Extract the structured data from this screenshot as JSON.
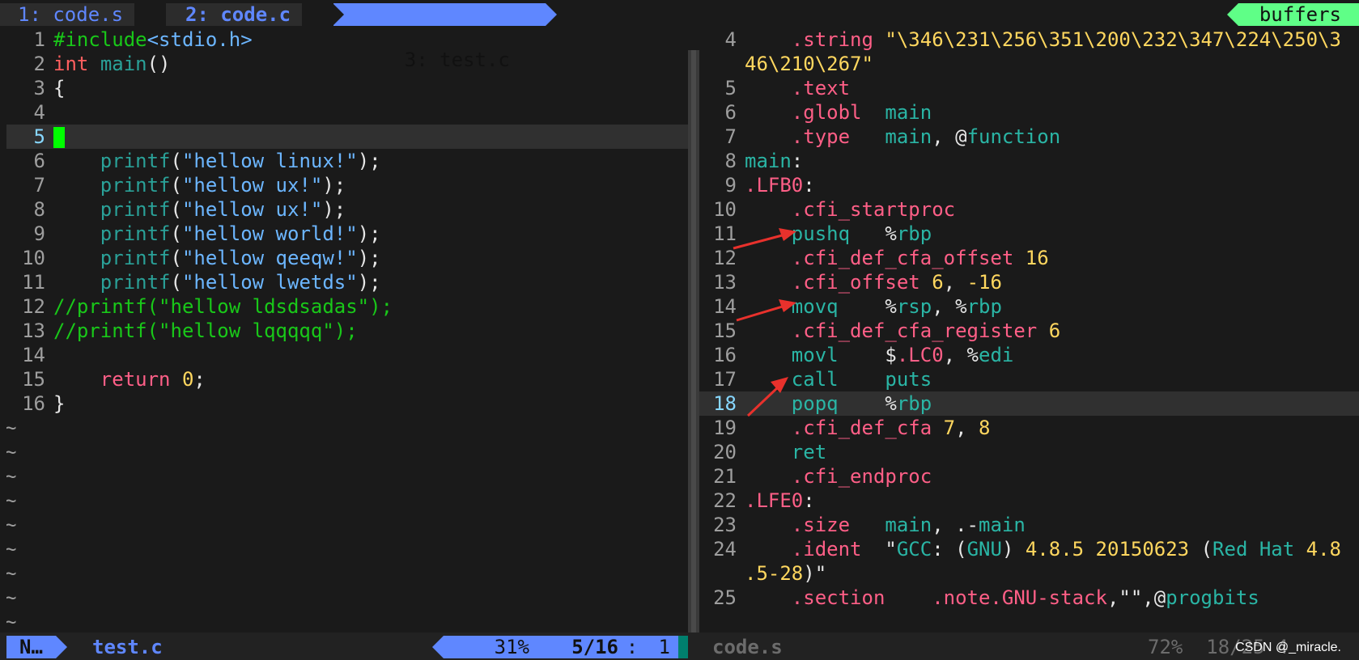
{
  "tabs": [
    {
      "label": "1: code.s"
    },
    {
      "label": "2: code.c"
    },
    {
      "label": "3: test.c"
    }
  ],
  "buffers_label": "buffers",
  "left_pane": {
    "lines": [
      {
        "n": "1",
        "parts": [
          [
            "cmt-green-inc",
            "#include"
          ],
          [
            "str-blue",
            "<stdio.h>"
          ]
        ]
      },
      {
        "n": "2",
        "parts": [
          [
            "kw-red",
            "int"
          ],
          [
            "white",
            " "
          ],
          [
            "fn-teal",
            "main"
          ],
          [
            "white",
            "()"
          ]
        ]
      },
      {
        "n": "3",
        "parts": [
          [
            "white",
            "{"
          ]
        ]
      },
      {
        "n": "4",
        "parts": []
      },
      {
        "n": "5",
        "parts": [],
        "current": true,
        "cursor": true
      },
      {
        "n": "6",
        "parts": [
          [
            "white",
            "    "
          ],
          [
            "fn-teal",
            "printf"
          ],
          [
            "white",
            "("
          ],
          [
            "str-blue",
            "\"hellow linux!\""
          ],
          [
            "white",
            ");"
          ]
        ]
      },
      {
        "n": "7",
        "parts": [
          [
            "white",
            "    "
          ],
          [
            "fn-teal",
            "printf"
          ],
          [
            "white",
            "("
          ],
          [
            "str-blue",
            "\"hellow ux!\""
          ],
          [
            "white",
            ");"
          ]
        ]
      },
      {
        "n": "8",
        "parts": [
          [
            "white",
            "    "
          ],
          [
            "fn-teal",
            "printf"
          ],
          [
            "white",
            "("
          ],
          [
            "str-blue",
            "\"hellow ux!\""
          ],
          [
            "white",
            ");"
          ]
        ]
      },
      {
        "n": "9",
        "parts": [
          [
            "white",
            "    "
          ],
          [
            "fn-teal",
            "printf"
          ],
          [
            "white",
            "("
          ],
          [
            "str-blue",
            "\"hellow world!\""
          ],
          [
            "white",
            ");"
          ]
        ]
      },
      {
        "n": "10",
        "parts": [
          [
            "white",
            "    "
          ],
          [
            "fn-teal",
            "printf"
          ],
          [
            "white",
            "("
          ],
          [
            "str-blue",
            "\"hellow qeeqw!\""
          ],
          [
            "white",
            ");"
          ]
        ]
      },
      {
        "n": "11",
        "parts": [
          [
            "white",
            "    "
          ],
          [
            "fn-teal",
            "printf"
          ],
          [
            "white",
            "("
          ],
          [
            "str-blue",
            "\"hellow lwetds\""
          ],
          [
            "white",
            ");"
          ]
        ]
      },
      {
        "n": "12",
        "parts": [
          [
            "cmt-green",
            "//printf(\"hellow ldsdsadas\");"
          ]
        ]
      },
      {
        "n": "13",
        "parts": [
          [
            "cmt-green",
            "//printf(\"hellow lqqqqq\");"
          ]
        ]
      },
      {
        "n": "14",
        "parts": []
      },
      {
        "n": "15",
        "parts": [
          [
            "white",
            "    "
          ],
          [
            "pink",
            "return"
          ],
          [
            "white",
            " "
          ],
          [
            "yellow",
            "0"
          ],
          [
            "white",
            ";"
          ]
        ]
      },
      {
        "n": "16",
        "parts": [
          [
            "white",
            "}"
          ]
        ]
      }
    ],
    "tildes": 9
  },
  "right_pane": {
    "lines": [
      {
        "n": "4",
        "parts": [
          [
            "white",
            "    "
          ],
          [
            "pink",
            ".string"
          ],
          [
            "white",
            " "
          ],
          [
            "yellow",
            "\"\\346\\231\\256\\351\\200\\232\\347\\224\\250\\3"
          ]
        ]
      },
      {
        "n": "",
        "parts": [
          [
            "yellow",
            "46\\210\\267\""
          ]
        ],
        "wrap": true
      },
      {
        "n": "5",
        "parts": [
          [
            "white",
            "    "
          ],
          [
            "pink",
            ".text"
          ]
        ]
      },
      {
        "n": "6",
        "parts": [
          [
            "white",
            "    "
          ],
          [
            "pink",
            ".globl"
          ],
          [
            "white",
            "  "
          ],
          [
            "teal",
            "main"
          ]
        ]
      },
      {
        "n": "7",
        "parts": [
          [
            "white",
            "    "
          ],
          [
            "pink",
            ".type"
          ],
          [
            "white",
            "   "
          ],
          [
            "teal",
            "main"
          ],
          [
            "white",
            ", @"
          ],
          [
            "teal",
            "function"
          ]
        ]
      },
      {
        "n": "8",
        "parts": [
          [
            "teal",
            "main"
          ],
          [
            "white",
            ":"
          ]
        ]
      },
      {
        "n": "9",
        "parts": [
          [
            "pink",
            ".LFB0"
          ],
          [
            "white",
            ":"
          ]
        ]
      },
      {
        "n": "10",
        "parts": [
          [
            "white",
            "    "
          ],
          [
            "pink",
            ".cfi_startproc"
          ]
        ]
      },
      {
        "n": "11",
        "parts": [
          [
            "white",
            "    "
          ],
          [
            "teal",
            "pushq"
          ],
          [
            "white",
            "   %"
          ],
          [
            "teal",
            "rbp"
          ]
        ]
      },
      {
        "n": "12",
        "parts": [
          [
            "white",
            "    "
          ],
          [
            "pink",
            ".cfi_def_cfa_offset"
          ],
          [
            "white",
            " "
          ],
          [
            "yellow",
            "16"
          ]
        ]
      },
      {
        "n": "13",
        "parts": [
          [
            "white",
            "    "
          ],
          [
            "pink",
            ".cfi_offset"
          ],
          [
            "white",
            " "
          ],
          [
            "yellow",
            "6"
          ],
          [
            "white",
            ", "
          ],
          [
            "yellow",
            "-16"
          ]
        ]
      },
      {
        "n": "14",
        "parts": [
          [
            "white",
            "    "
          ],
          [
            "teal",
            "movq"
          ],
          [
            "white",
            "    %"
          ],
          [
            "teal",
            "rsp"
          ],
          [
            "white",
            ", %"
          ],
          [
            "teal",
            "rbp"
          ]
        ]
      },
      {
        "n": "15",
        "parts": [
          [
            "white",
            "    "
          ],
          [
            "pink",
            ".cfi_def_cfa_register"
          ],
          [
            "white",
            " "
          ],
          [
            "yellow",
            "6"
          ]
        ]
      },
      {
        "n": "16",
        "parts": [
          [
            "white",
            "    "
          ],
          [
            "teal",
            "movl"
          ],
          [
            "white",
            "    $"
          ],
          [
            "pink",
            ".LC0"
          ],
          [
            "white",
            ", %"
          ],
          [
            "teal",
            "edi"
          ]
        ]
      },
      {
        "n": "17",
        "parts": [
          [
            "white",
            "    "
          ],
          [
            "teal",
            "call"
          ],
          [
            "white",
            "    "
          ],
          [
            "teal",
            "puts"
          ]
        ]
      },
      {
        "n": "18",
        "parts": [
          [
            "white",
            "    "
          ],
          [
            "teal",
            "popq"
          ],
          [
            "white",
            "    %"
          ],
          [
            "teal",
            "rbp"
          ]
        ],
        "current": true
      },
      {
        "n": "19",
        "parts": [
          [
            "white",
            "    "
          ],
          [
            "pink",
            ".cfi_def_cfa"
          ],
          [
            "white",
            " "
          ],
          [
            "yellow",
            "7"
          ],
          [
            "white",
            ", "
          ],
          [
            "yellow",
            "8"
          ]
        ]
      },
      {
        "n": "20",
        "parts": [
          [
            "white",
            "    "
          ],
          [
            "teal",
            "ret"
          ]
        ]
      },
      {
        "n": "21",
        "parts": [
          [
            "white",
            "    "
          ],
          [
            "pink",
            ".cfi_endproc"
          ]
        ]
      },
      {
        "n": "22",
        "parts": [
          [
            "pink",
            ".LFE0"
          ],
          [
            "white",
            ":"
          ]
        ]
      },
      {
        "n": "23",
        "parts": [
          [
            "white",
            "    "
          ],
          [
            "pink",
            ".size"
          ],
          [
            "white",
            "   "
          ],
          [
            "teal",
            "main"
          ],
          [
            "white",
            ", .-"
          ],
          [
            "teal",
            "main"
          ]
        ]
      },
      {
        "n": "24",
        "parts": [
          [
            "white",
            "    "
          ],
          [
            "pink",
            ".ident"
          ],
          [
            "white",
            "  \""
          ],
          [
            "teal",
            "GCC"
          ],
          [
            "white",
            ": ("
          ],
          [
            "teal",
            "GNU"
          ],
          [
            "white",
            ") "
          ],
          [
            "yellow",
            "4.8.5 20150623"
          ],
          [
            "white",
            " ("
          ],
          [
            "teal",
            "Red Hat"
          ],
          [
            "white",
            " "
          ],
          [
            "yellow",
            "4.8"
          ]
        ]
      },
      {
        "n": "",
        "parts": [
          [
            "yellow",
            ".5-28"
          ],
          [
            "white",
            ")\""
          ]
        ],
        "wrap": true
      },
      {
        "n": "25",
        "parts": [
          [
            "white",
            "    "
          ],
          [
            "pink",
            ".section"
          ],
          [
            "white",
            "    "
          ],
          [
            "pink",
            ".note.GNU-stack"
          ],
          [
            "white",
            ",\"\",@"
          ],
          [
            "teal",
            "progbits"
          ]
        ]
      }
    ],
    "tildes": 1
  },
  "statusbar": {
    "mode": "N…",
    "file": "test.c",
    "percent": "31%",
    "position": "5/16",
    "sep": ":",
    "col": "1",
    "file2": "code.s",
    "percent2": "72%",
    "position2": "18/25",
    "col2": "4"
  },
  "watermark": "CSDN @_miracle."
}
